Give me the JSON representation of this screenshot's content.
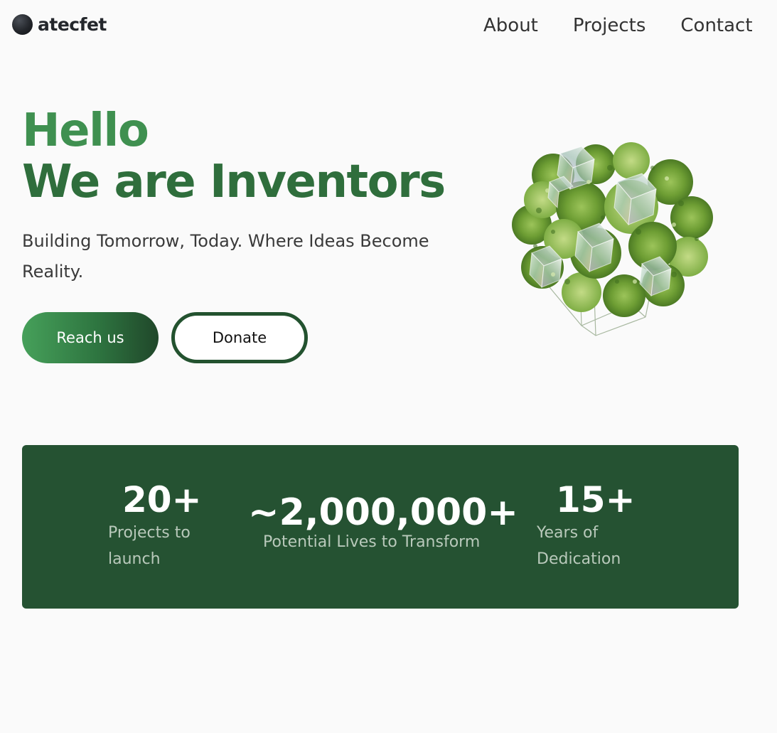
{
  "brand": {
    "name": "atecfet",
    "logo_icon": "dark-sphere-icon"
  },
  "nav": {
    "items": [
      {
        "label": "About"
      },
      {
        "label": "Projects"
      },
      {
        "label": "Contact"
      }
    ]
  },
  "hero": {
    "title_line1": "Hello",
    "title_line2": "We are Inventors",
    "subtitle": "Building Tomorrow, Today. Where Ideas Become Reality.",
    "primary_button": "Reach us",
    "secondary_button": "Donate",
    "image_description_icon": "green-glass-cube-illustration"
  },
  "stats": [
    {
      "value": "20+",
      "label": "Projects to launch"
    },
    {
      "value": "~2,000,000+",
      "label": "Potential Lives to Transform"
    },
    {
      "value": "15+",
      "label": "Years of Dedication"
    }
  ],
  "colors": {
    "background": "#fafafa",
    "brand_green": "#3f9050",
    "brand_green_dark": "#2f6e3c",
    "stats_panel": "#255232",
    "stats_label": "#b9c9bb",
    "text_dark": "#333333"
  }
}
